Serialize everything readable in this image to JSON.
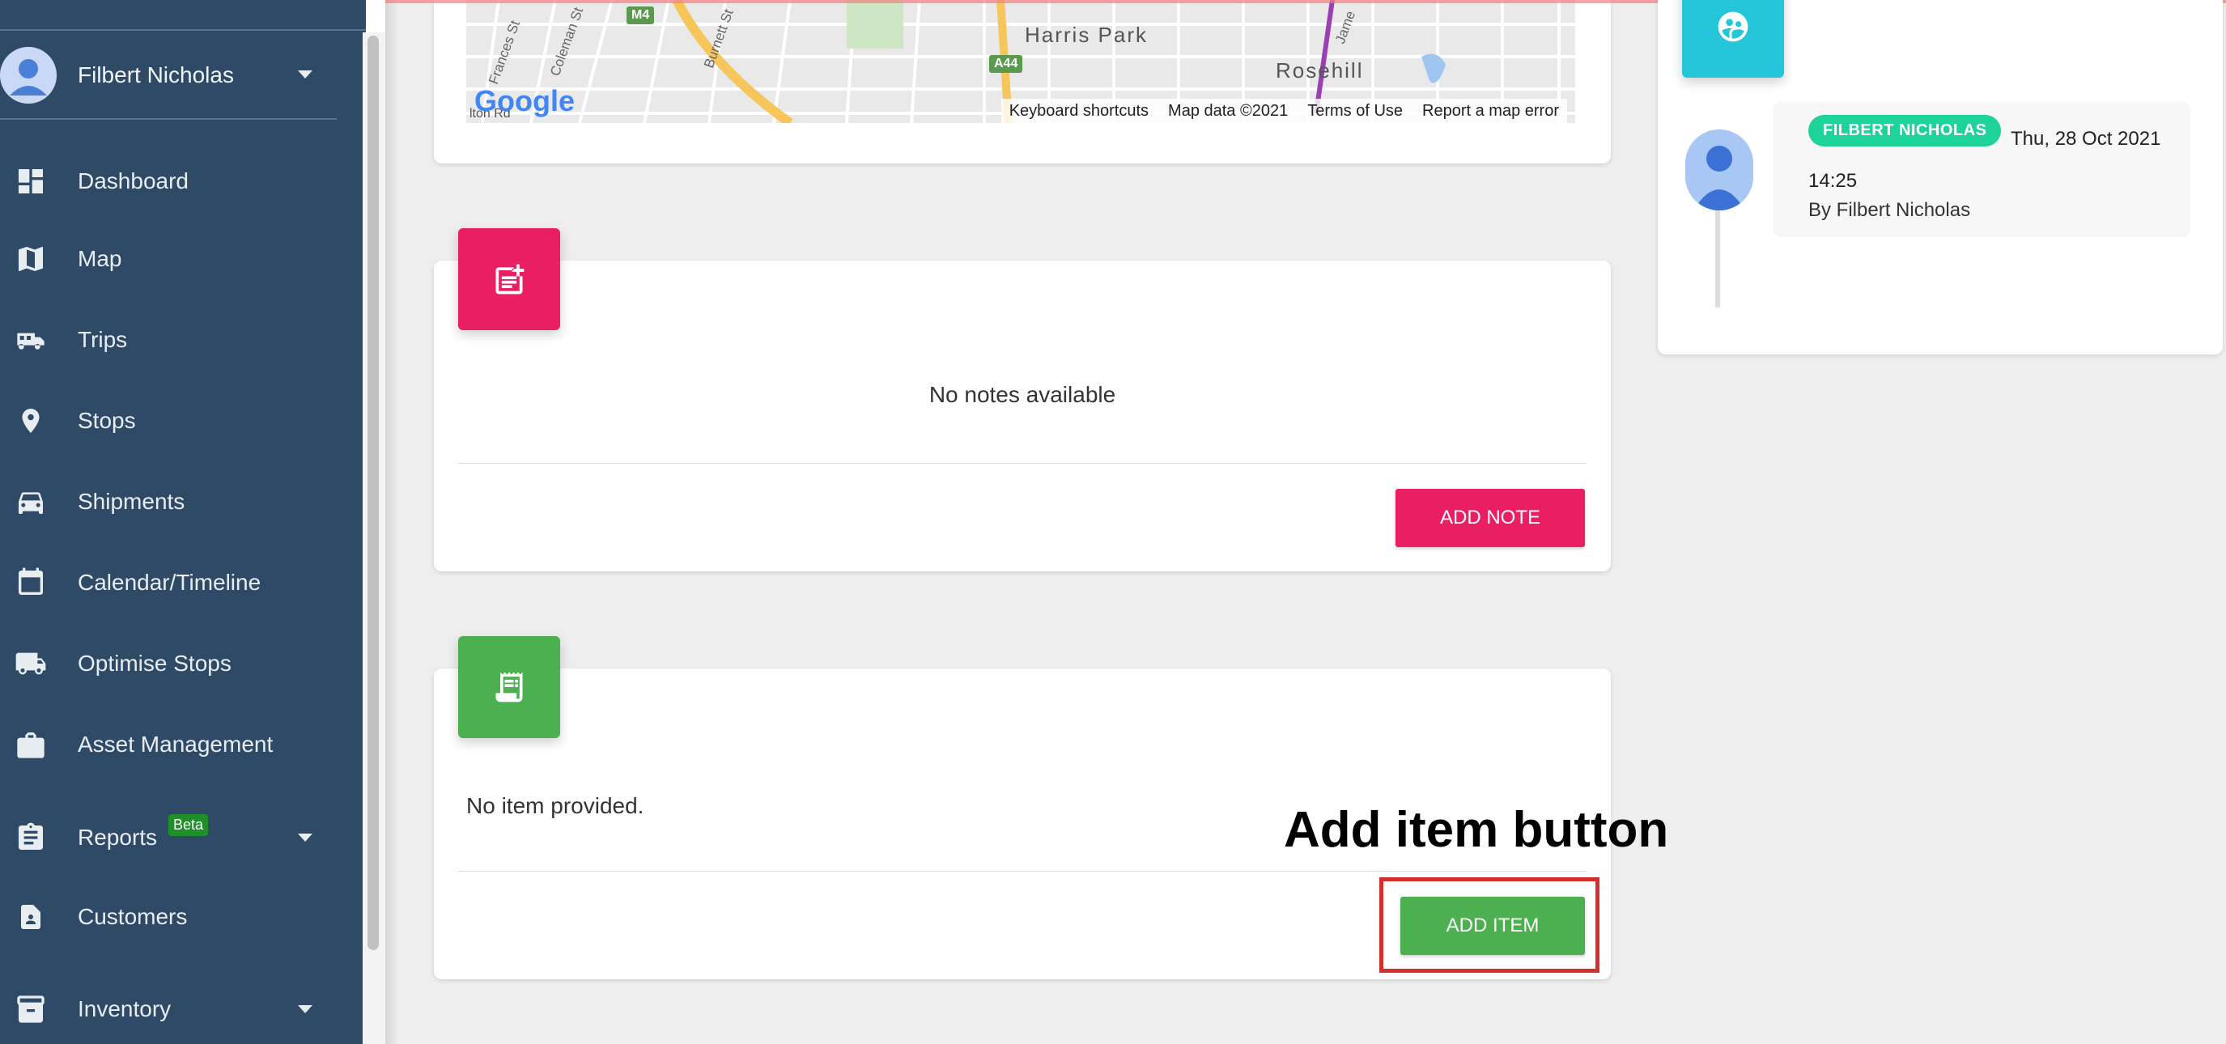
{
  "sidebar": {
    "user": {
      "name": "Filbert Nicholas"
    },
    "items": [
      {
        "label": "Dashboard",
        "icon": "dashboard-icon"
      },
      {
        "label": "Map",
        "icon": "map-icon"
      },
      {
        "label": "Trips",
        "icon": "bus-icon"
      },
      {
        "label": "Stops",
        "icon": "location-pin-icon"
      },
      {
        "label": "Shipments",
        "icon": "car-icon"
      },
      {
        "label": "Calendar/Timeline",
        "icon": "calendar-icon"
      },
      {
        "label": "Optimise Stops",
        "icon": "truck-icon"
      },
      {
        "label": "Asset Management",
        "icon": "briefcase-icon"
      },
      {
        "label": "Reports",
        "icon": "clipboard-icon",
        "badge": "Beta"
      },
      {
        "label": "Customers",
        "icon": "contact-file-icon"
      },
      {
        "label": "Inventory",
        "icon": "archive-box-icon"
      }
    ]
  },
  "map": {
    "places": [
      "Harris Park",
      "Rosehill"
    ],
    "road_shields": [
      "M4",
      "A44"
    ],
    "streets": [
      "Frances St",
      "Coleman St",
      "Burnett St",
      "Jame",
      "lton Rd"
    ],
    "logo": "Google",
    "attribution": {
      "shortcuts": "Keyboard shortcuts",
      "data": "Map data ©2021",
      "terms": "Terms of Use",
      "report": "Report a map error"
    }
  },
  "notes": {
    "empty_text": "No notes available",
    "add_label": "ADD NOTE"
  },
  "items": {
    "empty_text": "No item provided.",
    "add_label": "ADD ITEM"
  },
  "annotation": {
    "label": "Add item button"
  },
  "activity": {
    "user_badge": "FILBERT NICHOLAS",
    "date": "Thu, 28 Oct 2021 14:25",
    "by": "By Filbert Nicholas"
  },
  "colors": {
    "sidebar_bg": "#2f4a66",
    "notes_accent": "#e91e63",
    "items_accent": "#4caf50",
    "activity_accent": "#26c6da",
    "badge_green": "#1ed39a",
    "highlight_red": "#d32f2f"
  }
}
